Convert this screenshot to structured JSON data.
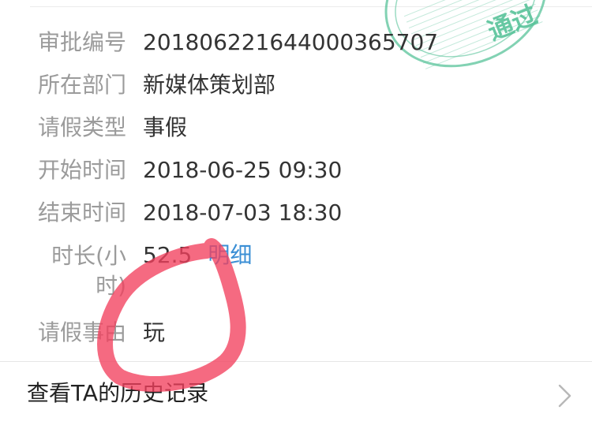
{
  "details": [
    {
      "label": "审批编号",
      "value": "201806221644000365707"
    },
    {
      "label": "所在部门",
      "value": "新媒体策划部"
    },
    {
      "label": "请假类型",
      "value": "事假"
    },
    {
      "label": "开始时间",
      "value": "2018-06-25 09:30"
    },
    {
      "label": "结束时间",
      "value": "2018-07-03 18:30"
    },
    {
      "label": "时长(小时)",
      "value": "52.5",
      "link": "明细"
    },
    {
      "label": "请假事由",
      "value": "玩"
    }
  ],
  "stamp": {
    "text": "通过",
    "color": "#58c39a"
  },
  "history": {
    "label": "查看TA的历史记录",
    "icon": "chevron-right-icon"
  },
  "colors": {
    "label": "#9b9b9b",
    "value": "#333333",
    "link": "#3b8fd5",
    "annotation": "#f2405e"
  }
}
